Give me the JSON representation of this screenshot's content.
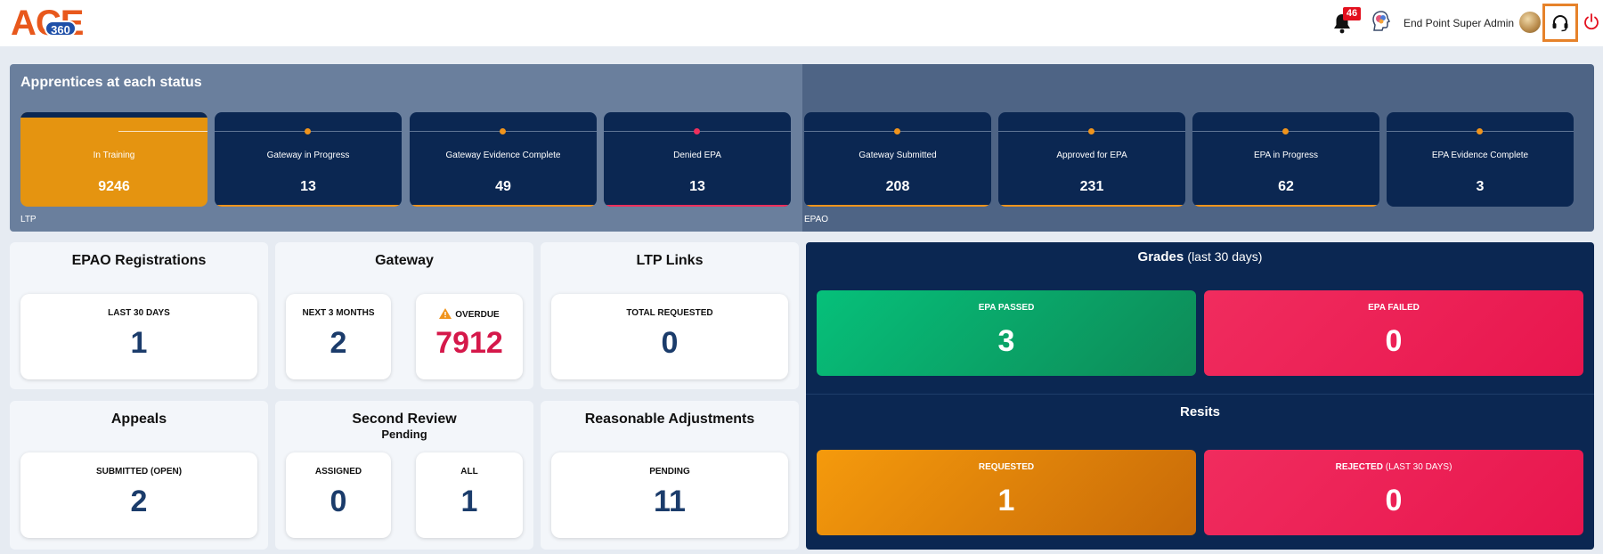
{
  "header": {
    "logo_text": "ACE",
    "logo_badge": "360",
    "notification_count": "46",
    "user_name": "End Point Super Admin"
  },
  "status_panel": {
    "title": "Apprentices at each status",
    "ltp_label": "LTP",
    "epao_label": "EPAO",
    "ltp_cards": [
      {
        "label": "In Training",
        "value": "9246"
      },
      {
        "label": "Gateway in Progress",
        "value": "13"
      },
      {
        "label": "Gateway Evidence Complete",
        "value": "49"
      },
      {
        "label": "Denied EPA",
        "value": "13"
      }
    ],
    "epao_cards": [
      {
        "label": "Gateway Submitted",
        "value": "208"
      },
      {
        "label": "Approved for EPA",
        "value": "231"
      },
      {
        "label": "EPA in Progress",
        "value": "62"
      },
      {
        "label": "EPA Evidence Complete",
        "value": "3"
      }
    ]
  },
  "epao_registrations": {
    "title": "EPAO Registrations",
    "label": "LAST 30 DAYS",
    "value": "1"
  },
  "gateway": {
    "title": "Gateway",
    "next_label": "NEXT 3 MONTHS",
    "next_value": "2",
    "overdue_label": "OVERDUE",
    "overdue_value": "7912"
  },
  "ltp_links": {
    "title": "LTP Links",
    "label": "TOTAL REQUESTED",
    "value": "0"
  },
  "appeals": {
    "title": "Appeals",
    "label": "SUBMITTED (OPEN)",
    "value": "2"
  },
  "second_review": {
    "title": "Second Review",
    "subtitle": "Pending",
    "assigned_label": "ASSIGNED",
    "assigned_value": "0",
    "all_label": "ALL",
    "all_value": "1"
  },
  "reasonable_adjustments": {
    "title": "Reasonable Adjustments",
    "label": "PENDING",
    "value": "11"
  },
  "grades": {
    "title": "Grades",
    "period": "(last 30 days)",
    "passed_label": "EPA PASSED",
    "passed_value": "3",
    "failed_label": "EPA FAILED",
    "failed_value": "0"
  },
  "resits": {
    "title": "Resits",
    "requested_label": "REQUESTED",
    "requested_value": "1",
    "rejected_label": "REJECTED",
    "rejected_period": "(LAST 30 DAYS)",
    "rejected_value": "0"
  },
  "colors": {
    "accent_orange": "#e59410",
    "navy": "#0b2752",
    "danger": "#d5184a",
    "success": "#06c07a"
  }
}
